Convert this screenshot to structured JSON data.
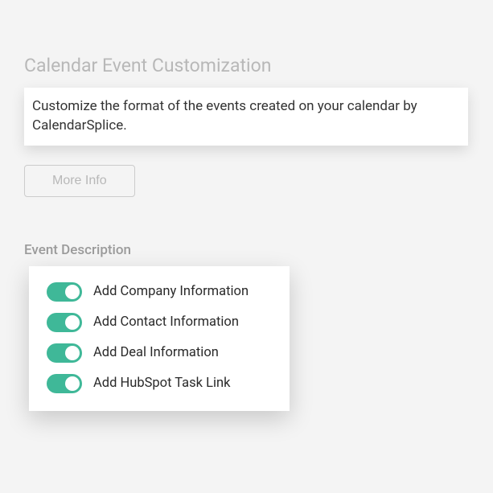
{
  "header": {
    "title": "Calendar Event Customization",
    "description": "Customize the format of the events created on your calendar by CalendarSplice.",
    "more_info_label": "More Info"
  },
  "section": {
    "label": "Event Description"
  },
  "toggles": {
    "items": [
      {
        "label": "Add Company Information",
        "on": true
      },
      {
        "label": "Add Contact Information",
        "on": true
      },
      {
        "label": "Add Deal Information",
        "on": true
      },
      {
        "label": "Add HubSpot Task Link",
        "on": true
      }
    ]
  },
  "colors": {
    "toggle_on": "#3fb898",
    "muted_text": "#b8b8b8"
  }
}
